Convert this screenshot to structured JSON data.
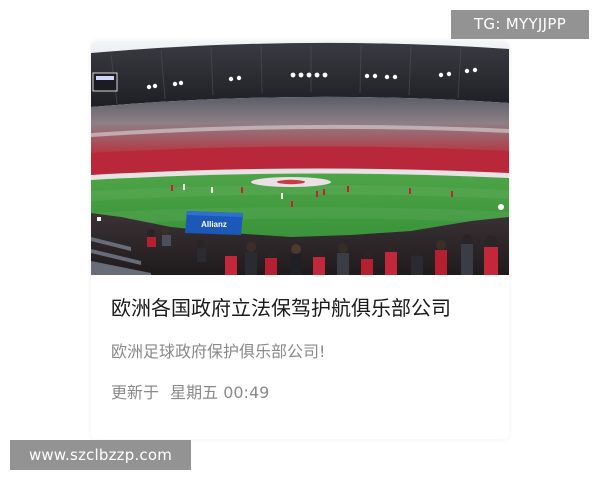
{
  "watermark_top": "TG: MYYJJPP",
  "watermark_bottom": "www.szclbzzp.com",
  "card": {
    "image_alt": "",
    "banner_text": "Allianz",
    "title": "欧洲各国政府立法保驾护航俱乐部公司",
    "description": "欧洲足球政府保护俱乐部公司!",
    "updated_label": "更新于",
    "updated_time": "星期五 00:49"
  },
  "colors": {
    "pitch": "#3f9a3a",
    "stands_red": "#b8283a",
    "roof": "#2b2b30",
    "title": "#1a1a1a",
    "muted": "#8a8a8a"
  }
}
